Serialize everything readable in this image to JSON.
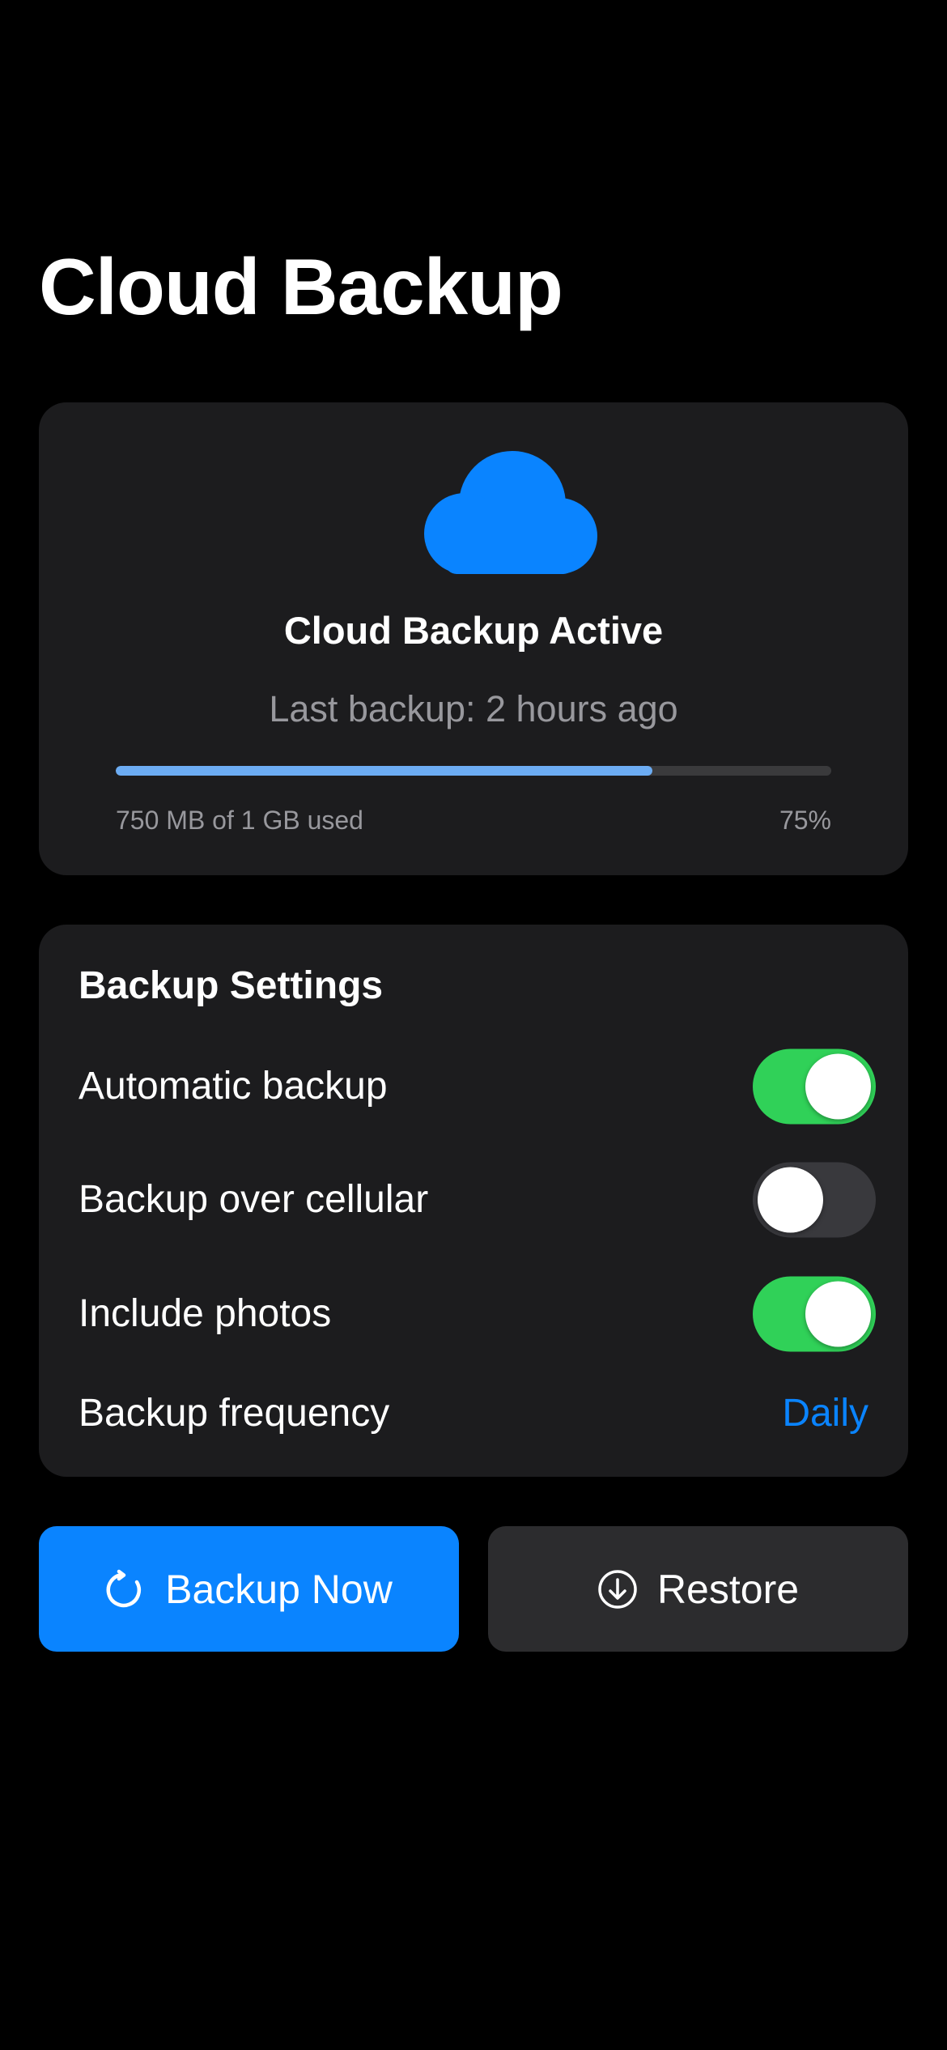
{
  "page": {
    "title": "Cloud Backup"
  },
  "status_card": {
    "icon": "cloud-icon",
    "title": "Cloud Backup Active",
    "last_backup": "Last backup: 2 hours ago",
    "storage_used_label": "750 MB of 1 GB used",
    "storage_percent_label": "75%",
    "storage_fraction": 0.75
  },
  "settings": {
    "title": "Backup Settings",
    "rows": [
      {
        "label": "Automatic backup",
        "type": "toggle",
        "on": true
      },
      {
        "label": "Backup over cellular",
        "type": "toggle",
        "on": false
      },
      {
        "label": "Include photos",
        "type": "toggle",
        "on": true
      },
      {
        "label": "Backup frequency",
        "type": "value",
        "value": "Daily"
      }
    ]
  },
  "actions": {
    "backup_now": {
      "label": "Backup Now",
      "icon": "refresh-icon"
    },
    "restore": {
      "label": "Restore",
      "icon": "download-circle-icon"
    }
  },
  "colors": {
    "accent": "#0a84ff",
    "toggle_on": "#30d158",
    "card_bg": "#1c1c1e",
    "progress_fill": "#6cacf3"
  }
}
